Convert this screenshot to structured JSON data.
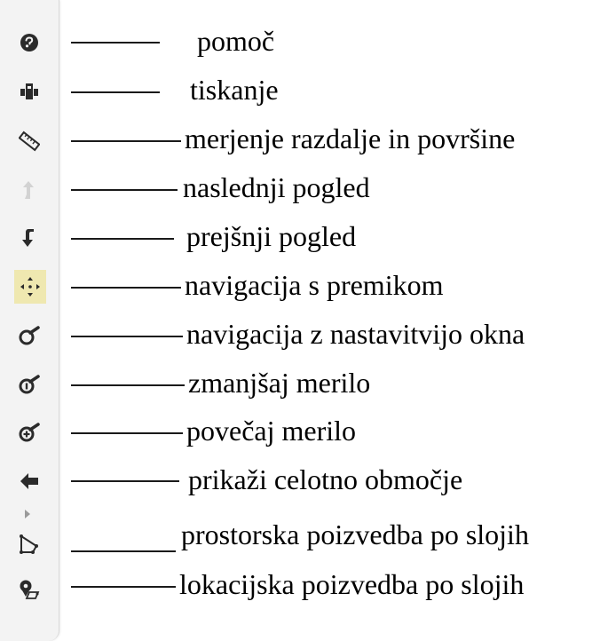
{
  "tools": [
    {
      "id": "help",
      "icon": "help-icon",
      "label": "pomoč"
    },
    {
      "id": "print",
      "icon": "printer-icon",
      "label": "tiskanje"
    },
    {
      "id": "measure",
      "icon": "ruler-icon",
      "label": "merjenje razdalje in površine"
    },
    {
      "id": "next",
      "icon": "next-view-icon",
      "label": "naslednji pogled"
    },
    {
      "id": "prev",
      "icon": "previous-view-icon",
      "label": "prejšnji pogled"
    },
    {
      "id": "pan",
      "icon": "pan-icon",
      "label": "navigacija s premikom",
      "active": true
    },
    {
      "id": "zoombox",
      "icon": "zoom-box-icon",
      "label": "navigacija z nastavitvijo okna"
    },
    {
      "id": "zoomout",
      "icon": "zoom-out-icon",
      "label": "zmanjšaj merilo"
    },
    {
      "id": "zoomin",
      "icon": "zoom-in-icon",
      "label": "povečaj merilo"
    },
    {
      "id": "fullextent",
      "icon": "full-extent-icon",
      "label": "prikaži celotno območje"
    },
    {
      "id": "spatialquery",
      "icon": "spatial-query-icon",
      "label": "prostorska poizvedba po slojih"
    },
    {
      "id": "locationquery",
      "icon": "location-query-icon",
      "label": "lokacijska poizvedba po slojih"
    }
  ],
  "colors": {
    "toolbar_bg": "#f3f3f3",
    "active_bg": "#efe8b0",
    "icon": "#2b2b2b",
    "icon_disabled": "#d2d2d2"
  }
}
